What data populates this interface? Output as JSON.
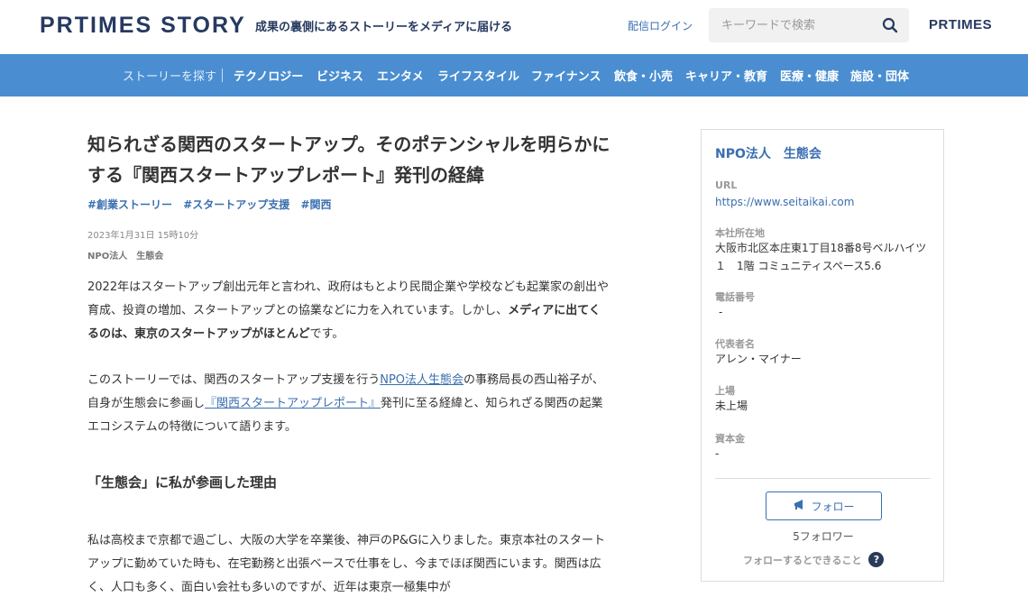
{
  "header": {
    "logo": "PRTIMES STORY",
    "tagline": "成果の裏側にあるストーリーをメディアに届ける",
    "login": "配信ログイン",
    "search_placeholder": "キーワードで検索",
    "pr_logo": "PRTIMES"
  },
  "nav": {
    "items": [
      "ストーリーを探す",
      "テクノロジー",
      "ビジネス",
      "エンタメ",
      "ライフスタイル",
      "ファイナンス",
      "飲食・小売",
      "キャリア・教育",
      "医療・健康",
      "施設・団体"
    ]
  },
  "article": {
    "title": "知られざる関西のスタートアップ。そのポテンシャルを明らかにする『関西スタートアップレポート』発刊の経緯",
    "tags": [
      "#創業ストーリー",
      "#スタートアップ支援",
      "#関西"
    ],
    "date": "2023年1月31日 15時10分",
    "author": "NPO法人　生態会",
    "p1_a": "2022年はスタートアップ創出元年と言われ、政府はもとより民間企業や学校なども起業家の創出や育成、投資の増加、スタートアップとの協業などに力を入れています。しかし、",
    "p1_b": "メディアに出てくるのは、東京のスタートアップがほとんど",
    "p1_c": "です。",
    "p2_a": "このストーリーでは、関西のスタートアップ支援を行う",
    "p2_link1": "NPO法人生態会",
    "p2_b": "の事務局長の西山裕子が、自身が生態会に参画し",
    "p2_link2": "『関西スタートアップレポート』",
    "p2_c": "発刊に至る経緯と、知られざる関西の起業エコシステムの特徴について語ります。",
    "heading": "「生態会」に私が参画した理由",
    "p3": "私は高校まで京都で過ごし、大阪の大学を卒業後、神戸のP&Gに入りました。東京本社のスタートアップに勤めていた時も、在宅勤務と出張ベースで仕事をし、今までほぼ関西にいます。関西は広く、人口も多く、面白い会社も多いのですが、近年は東京一極集中が"
  },
  "sidebar": {
    "org_name": "NPO法人　生態会",
    "fields": [
      {
        "label": "URL",
        "value": "https://www.seitaikai.com"
      },
      {
        "label": "本社所在地",
        "value": "大阪市北区本庄東1丁目18番8号ベルハイツ１　1階 コミュニティスペース5.6"
      },
      {
        "label": "電話番号",
        "value": "-"
      },
      {
        "label": "代表者名",
        "value": "アレン・マイナー"
      },
      {
        "label": "上場",
        "value": "未上場"
      },
      {
        "label": "資本金",
        "value": "-"
      }
    ],
    "follow_label": "フォロー",
    "follower_count": "5フォロワー",
    "follow_help": "フォローするとできること",
    "help_glyph": "?"
  },
  "colors": {
    "brand_navy": "#263960",
    "nav_blue": "#4a8ed1",
    "link_blue": "#3a6fb0"
  },
  "icons": {
    "search": "search-icon",
    "follow": "megaphone-icon",
    "help": "question-icon"
  }
}
